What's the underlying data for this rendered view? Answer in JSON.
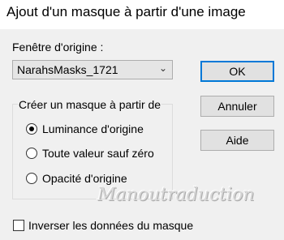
{
  "window": {
    "title": "Ajout d'un masque à partir d'une image"
  },
  "source": {
    "label": "Fenêtre d'origine :",
    "selected": "NarahsMasks_1721",
    "dropdown_icon": "chevron-down-icon"
  },
  "group": {
    "legend": "Créer un masque à partir de",
    "options": [
      {
        "label": "Luminance d'origine",
        "selected": true
      },
      {
        "label": "Toute valeur sauf zéro",
        "selected": false
      },
      {
        "label": "Opacité d'origine",
        "selected": false
      }
    ]
  },
  "invert": {
    "label": "Inverser les données du masque",
    "checked": false
  },
  "buttons": {
    "ok": "OK",
    "cancel": "Annuler",
    "help": "Aide"
  },
  "watermark": "Manoutraduction",
  "colors": {
    "focus_border": "#0078d7",
    "button_face": "#e1e1e1",
    "dialog_bg": "#f0f0f0"
  }
}
